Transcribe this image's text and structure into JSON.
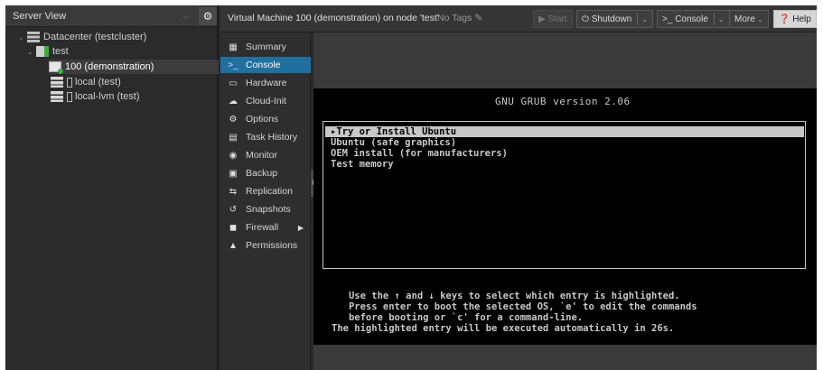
{
  "tree": {
    "header": "Server View",
    "nodes": [
      {
        "label": "Datacenter (testcluster)"
      },
      {
        "label": "test"
      },
      {
        "label": "100 (demonstration)"
      },
      {
        "label": "local (test)"
      },
      {
        "label": "local-lvm (test)"
      }
    ]
  },
  "toolbar": {
    "vm_title": "Virtual Machine 100 (demonstration) on node 'test'",
    "tags": "No Tags",
    "start": "Start",
    "shutdown": "Shutdown",
    "console": "Console",
    "more": "More",
    "help": "Help"
  },
  "nav": {
    "items": [
      {
        "label": "Summary",
        "icon": "book-icon"
      },
      {
        "label": "Console",
        "icon": "terminal-icon"
      },
      {
        "label": "Hardware",
        "icon": "monitor-icon"
      },
      {
        "label": "Cloud-Init",
        "icon": "cloud-icon"
      },
      {
        "label": "Options",
        "icon": "gear-icon"
      },
      {
        "label": "Task History",
        "icon": "list-icon"
      },
      {
        "label": "Monitor",
        "icon": "eye-icon"
      },
      {
        "label": "Backup",
        "icon": "floppy-icon"
      },
      {
        "label": "Replication",
        "icon": "retweet-icon"
      },
      {
        "label": "Snapshots",
        "icon": "history-icon"
      },
      {
        "label": "Firewall",
        "icon": "shield-icon"
      },
      {
        "label": "Permissions",
        "icon": "unlock-icon"
      }
    ]
  },
  "console": {
    "version": "GNU GRUB  version 2.06",
    "entries": [
      "Try or Install Ubuntu",
      "Ubuntu (safe graphics)",
      "OEM install (for manufacturers)",
      "Test memory"
    ],
    "help": [
      "   Use the ↑ and ↓ keys to select which entry is highlighted.",
      "   Press enter to boot the selected OS, `e' to edit the commands",
      "   before booting or `c' for a command-line.",
      "The highlighted entry will be executed automatically in 26s."
    ]
  },
  "colors": {
    "accent": "#1f6f9f",
    "node_green": "#3fae3f"
  }
}
